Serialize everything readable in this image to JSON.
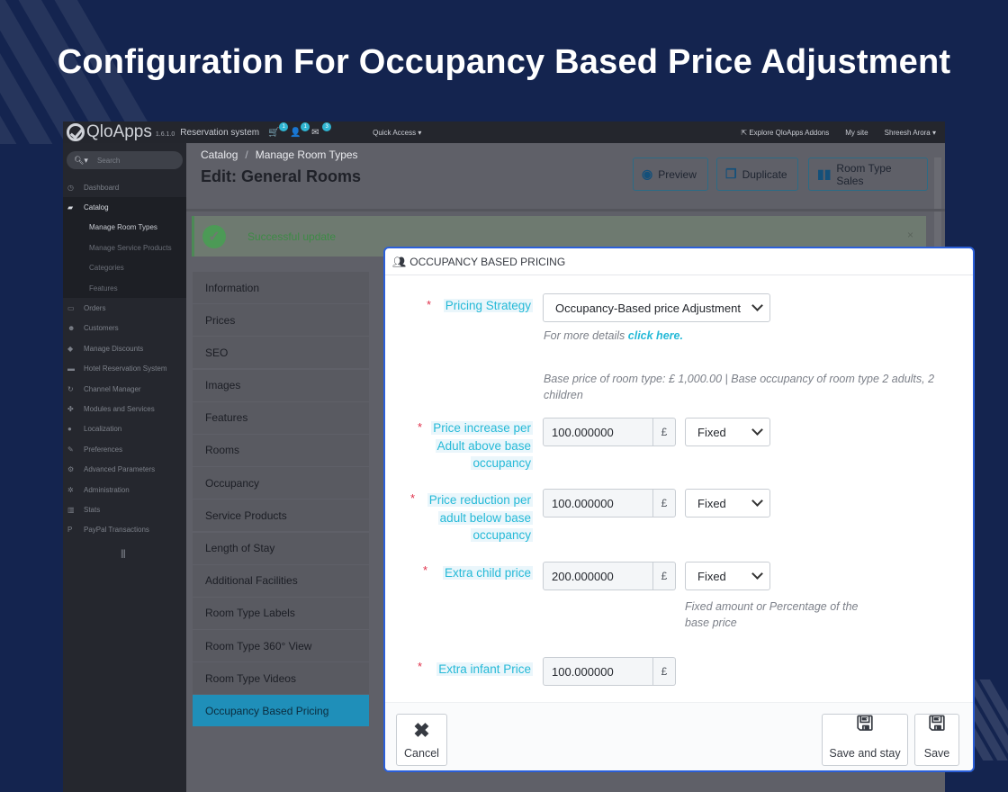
{
  "headline": "Configuration For Occupancy Based Price Adjustment",
  "topbar": {
    "logo": "QloApps",
    "version": "1.6.1.0",
    "reservation_system": "Reservation system",
    "cart_count": "1",
    "customers_count": "1",
    "messages_count": "3",
    "quick_access": "Quick Access ▾",
    "explore_addons": "Explore QloApps Addons",
    "my_site": "My site",
    "user": "Shreesh Arora ▾"
  },
  "sidebar": {
    "search_placeholder": "Search",
    "items": [
      {
        "label": "Dashboard",
        "icon": "dashboard-icon"
      },
      {
        "label": "Catalog",
        "icon": "catalog-icon"
      },
      {
        "label": "Orders",
        "icon": "orders-icon"
      },
      {
        "label": "Customers",
        "icon": "customers-icon"
      },
      {
        "label": "Manage Discounts",
        "icon": "discount-icon"
      },
      {
        "label": "Hotel Reservation System",
        "icon": "bed-icon"
      },
      {
        "label": "Channel Manager",
        "icon": "sync-icon"
      },
      {
        "label": "Modules and Services",
        "icon": "puzzle-icon"
      },
      {
        "label": "Localization",
        "icon": "globe-icon"
      },
      {
        "label": "Preferences",
        "icon": "wrench-icon"
      },
      {
        "label": "Advanced Parameters",
        "icon": "cogs-icon"
      },
      {
        "label": "Administration",
        "icon": "gear-icon"
      },
      {
        "label": "Stats",
        "icon": "stats-icon"
      },
      {
        "label": "PayPal Transactions",
        "icon": "paypal-icon"
      }
    ],
    "catalog_sub": [
      "Manage Room Types",
      "Manage Service Products",
      "Categories",
      "Features"
    ]
  },
  "breadcrumb": {
    "parent": "Catalog",
    "current": "Manage Room Types"
  },
  "page_title": "Edit: General Rooms",
  "toolbar": {
    "preview": "Preview",
    "duplicate": "Duplicate",
    "sales": "Room Type Sales"
  },
  "alert": {
    "message": "Successful update",
    "close": "×"
  },
  "tabs": [
    "Information",
    "Prices",
    "SEO",
    "Images",
    "Features",
    "Rooms",
    "Occupancy",
    "Service Products",
    "Length of Stay",
    "Additional Facilities",
    "Room Type Labels",
    "Room Type 360° View",
    "Room Type Videos",
    "Occupancy Based Pricing"
  ],
  "modal": {
    "title": "OCCUPANCY BASED PRICING",
    "pricing_strategy": {
      "label": "Pricing Strategy",
      "value": "Occupancy-Based price Adjustment",
      "help_prefix": "For more details ",
      "help_link": "click here."
    },
    "base_info": "Base price of room type: £ 1,000.00  |  Base occupancy of room type 2 adults, 2 children",
    "currency": "£",
    "adult_increase": {
      "label": "Price increase per Adult above base occupancy",
      "value": "100.000000",
      "type": "Fixed"
    },
    "adult_reduction": {
      "label": "Price reduction per adult below base occupancy",
      "value": "100.000000",
      "type": "Fixed"
    },
    "child_price": {
      "label": "Extra child price",
      "value": "200.000000",
      "type": "Fixed",
      "help": "Fixed amount or Percentage of the base price"
    },
    "infant_price": {
      "label": "Extra infant Price",
      "value": "100.000000"
    },
    "required_mark": "*"
  },
  "footer": {
    "cancel": "Cancel",
    "save_stay": "Save and stay",
    "save": "Save"
  }
}
